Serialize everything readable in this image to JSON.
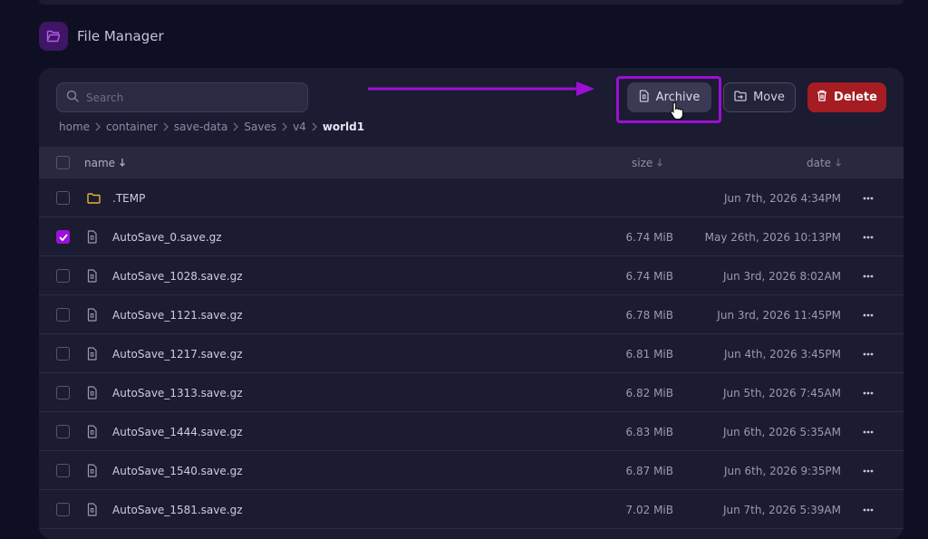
{
  "header": {
    "title": "File Manager",
    "icon": "folder-open-icon"
  },
  "search": {
    "placeholder": "Search",
    "value": ""
  },
  "breadcrumb": [
    "home",
    "container",
    "save-data",
    "Saves",
    "v4"
  ],
  "breadcrumb_current": "world1",
  "actions": {
    "archive": "Archive",
    "move": "Move",
    "delete": "Delete"
  },
  "table": {
    "col_name": "name",
    "col_size": "size",
    "col_date": "date",
    "rows": [
      {
        "type": "folder",
        "name": ".TEMP",
        "size": "",
        "date": "Jun 7th, 2026 4:34PM",
        "checked": false
      },
      {
        "type": "file",
        "name": "AutoSave_0.save.gz",
        "size": "6.74 MiB",
        "date": "May 26th, 2026 10:13PM",
        "checked": true
      },
      {
        "type": "file",
        "name": "AutoSave_1028.save.gz",
        "size": "6.74 MiB",
        "date": "Jun 3rd, 2026 8:02AM",
        "checked": false
      },
      {
        "type": "file",
        "name": "AutoSave_1121.save.gz",
        "size": "6.78 MiB",
        "date": "Jun 3rd, 2026 11:45PM",
        "checked": false
      },
      {
        "type": "file",
        "name": "AutoSave_1217.save.gz",
        "size": "6.81 MiB",
        "date": "Jun 4th, 2026 3:45PM",
        "checked": false
      },
      {
        "type": "file",
        "name": "AutoSave_1313.save.gz",
        "size": "6.82 MiB",
        "date": "Jun 5th, 2026 7:45AM",
        "checked": false
      },
      {
        "type": "file",
        "name": "AutoSave_1444.save.gz",
        "size": "6.83 MiB",
        "date": "Jun 6th, 2026 5:35AM",
        "checked": false
      },
      {
        "type": "file",
        "name": "AutoSave_1540.save.gz",
        "size": "6.87 MiB",
        "date": "Jun 6th, 2026 9:35PM",
        "checked": false
      },
      {
        "type": "file",
        "name": "AutoSave_1581.save.gz",
        "size": "7.02 MiB",
        "date": "Jun 7th, 2026 5:39AM",
        "checked": false
      }
    ]
  },
  "colors": {
    "accent": "#9b12d6",
    "delete": "#a51c22",
    "folder": "#e6b32a",
    "annotation": "#9c10d2"
  }
}
